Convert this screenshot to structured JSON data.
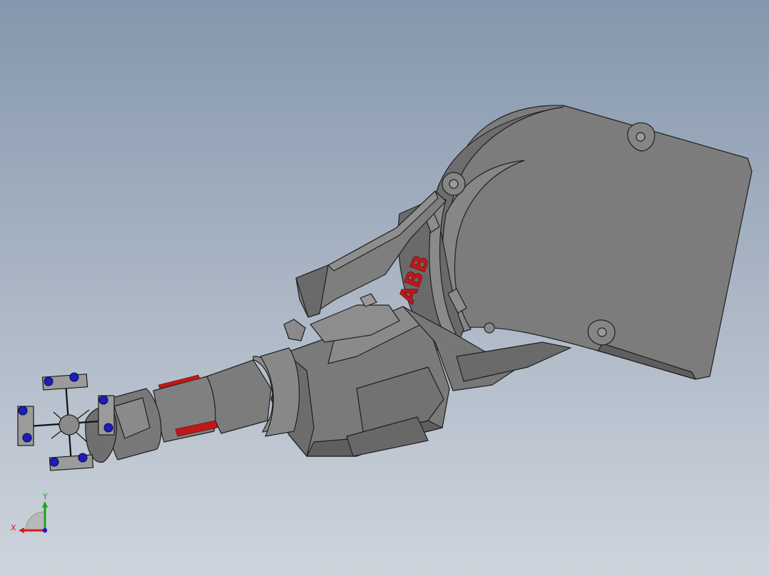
{
  "viewport": {
    "background_top": "#8597ad",
    "background_bottom": "#cdd4dc"
  },
  "model": {
    "logo_text": "ABB",
    "logo_color": "#c01818",
    "body_color": "#7c7c7c",
    "shadow_color": "#5e5e5e",
    "edge_color": "#1f1f1f",
    "gripper_cap_color": "#1d1db8"
  },
  "triad": {
    "x_label": "X",
    "y_label": "Y",
    "x_color": "#d81b1b",
    "y_color": "#1aa51a",
    "z_color": "#1b1bd0"
  }
}
